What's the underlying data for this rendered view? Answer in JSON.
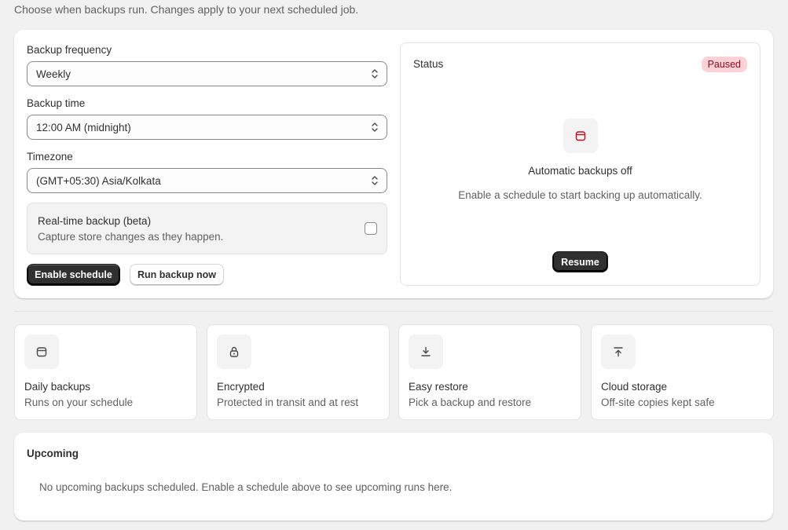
{
  "page": {
    "subtitle": "Choose when backups run. Changes apply to your next scheduled job."
  },
  "schedule_form": {
    "frequency": {
      "label": "Backup frequency",
      "value": "Weekly"
    },
    "time": {
      "label": "Backup time",
      "value": "12:00 AM (midnight)"
    },
    "timezone": {
      "label": "Timezone",
      "value": "(GMT+05:30) Asia/Kolkata"
    },
    "realtime": {
      "title": "Real-time backup (beta)",
      "description": "Capture store changes as they happen.",
      "checked": false
    },
    "enable_label": "Enable schedule",
    "run_now_label": "Run backup now"
  },
  "status": {
    "label": "Status",
    "badge": "Paused",
    "empty_title": "Automatic backups off",
    "empty_description": "Enable a schedule to start backing up automatically.",
    "resume_label": "Resume"
  },
  "features": [
    {
      "icon": "calendar-icon",
      "title": "Daily backups",
      "description": "Runs on your schedule"
    },
    {
      "icon": "lock-icon",
      "title": "Encrypted",
      "description": "Protected in transit and at rest"
    },
    {
      "icon": "download-icon",
      "title": "Easy restore",
      "description": "Pick a backup and restore"
    },
    {
      "icon": "upload-icon",
      "title": "Cloud storage",
      "description": "Off-site copies kept safe"
    }
  ],
  "upcoming": {
    "title": "Upcoming",
    "empty_text": "No upcoming backups scheduled. Enable a schedule above to see upcoming runs here."
  },
  "colors": {
    "primary_button": "#303030",
    "badge_bg": "#fed1d7",
    "badge_text": "#8e0b21",
    "status_icon": "#c70a24"
  }
}
